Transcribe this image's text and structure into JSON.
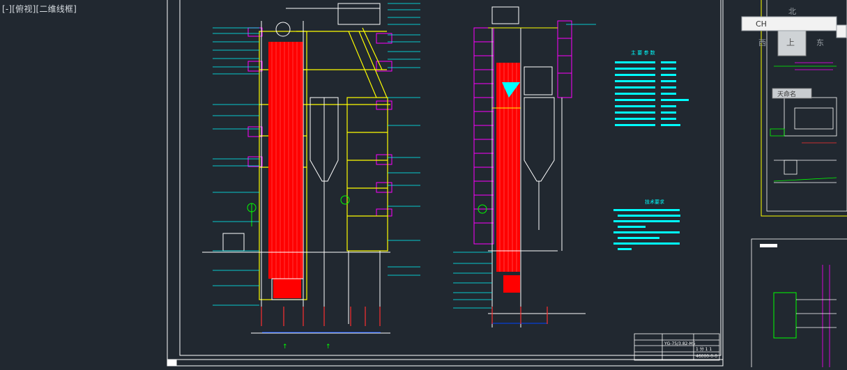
{
  "viewport": {
    "label": "[-][俯视][二维线框]",
    "background": "#212830"
  },
  "drawing": {
    "section_a_title": "主 要 参 数",
    "section_b_title": "技术要求",
    "title_block_code": "YG-75/3.82-M5",
    "title_block_sheet": "1 分 1 1",
    "title_block_number": "46000-0-0"
  },
  "viewcube": {
    "north": "北",
    "west": "西",
    "east": "东",
    "top": "上",
    "wcs": "天命名",
    "ime": "CH"
  },
  "colors": {
    "grid_background": "#212830",
    "frame": "#ffffff",
    "red_fill": "#ff0000",
    "yellow": "#ffff00",
    "green": "#00ff00",
    "cyan": "#00ffff",
    "magenta": "#ff00ff",
    "blue": "#0044ff"
  }
}
